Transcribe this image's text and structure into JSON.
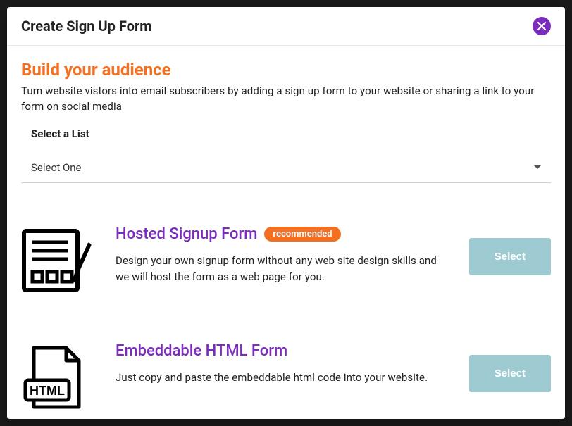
{
  "modal": {
    "title": "Create Sign Up Form"
  },
  "section": {
    "title": "Build your audience",
    "subtitle": "Turn website vistors into email subscribers by adding a sign up form to your website or sharing a link to your form on social media"
  },
  "list_field": {
    "label": "Select a List",
    "value": "Select One"
  },
  "options": {
    "hosted": {
      "title": "Hosted Signup Form",
      "badge": "recommended",
      "desc": "Design your own signup form without any web site design skills and we will host the form as a web page for you.",
      "button": "Select"
    },
    "embed": {
      "title": "Embeddable HTML Form",
      "desc": "Just copy and paste the embeddable html code into your website.",
      "button": "Select"
    }
  }
}
